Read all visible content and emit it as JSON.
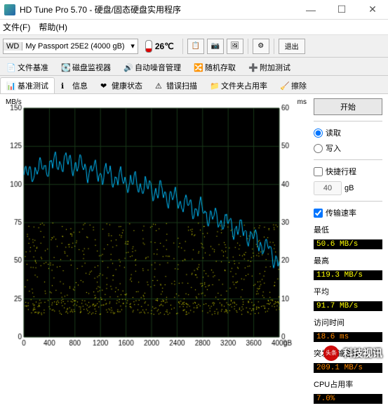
{
  "window": {
    "title": "HD Tune Pro 5.70 - 硬盘/固态硬盘实用程序",
    "min": "—",
    "max": "☐",
    "close": "✕"
  },
  "menu": {
    "file": "文件(F)",
    "help": "帮助(H)"
  },
  "drive": {
    "vendor": "WD",
    "model": "My Passport 25E2 (4000 gB)",
    "dd": "▾"
  },
  "temp": "26℃",
  "toolbar": {
    "copy": "📋",
    "shot": "📷",
    "cap": "🖼",
    "opt": "⚙",
    "exit": "退出"
  },
  "tabs_row1": [
    {
      "icon": "📄",
      "label": "文件基准"
    },
    {
      "icon": "💽",
      "label": "磁盘监视器"
    },
    {
      "icon": "🔊",
      "label": "自动噪音管理"
    },
    {
      "icon": "🔀",
      "label": "随机存取"
    },
    {
      "icon": "➕",
      "label": "附加测试"
    }
  ],
  "tabs_row2": [
    {
      "icon": "📊",
      "label": "基准测试",
      "active": true
    },
    {
      "icon": "ℹ",
      "label": "信息"
    },
    {
      "icon": "❤",
      "label": "健康状态"
    },
    {
      "icon": "⚠",
      "label": "错误扫描"
    },
    {
      "icon": "📁",
      "label": "文件夹占用率"
    },
    {
      "icon": "🧹",
      "label": "擦除"
    }
  ],
  "chart": {
    "ylabel_left": "MB/s",
    "ylabel_right": "ms",
    "xlabel": "gB"
  },
  "side": {
    "start": "开始",
    "read": "读取",
    "write": "写入",
    "short": "快捷行程",
    "short_val": "40",
    "short_unit": "gB",
    "transfer": "传输速率",
    "min_l": "最低",
    "min_v": "50.6 MB/s",
    "max_l": "最高",
    "max_v": "119.3 MB/s",
    "avg_l": "平均",
    "avg_v": "91.7 MB/s",
    "acc_l": "访问时间",
    "acc_v": "18.6 ms",
    "burst_l": "突发传输速率",
    "burst_v": "209.1 MB/s",
    "cpu_l": "CPU占用率",
    "cpu_v": "7.0%"
  },
  "watermark": {
    "logo": "头条",
    "name": "科技视讯"
  },
  "chart_data": {
    "type": "line+scatter",
    "xlim": [
      0,
      4000
    ],
    "x_ticks": [
      0,
      400,
      800,
      1200,
      1600,
      2000,
      2400,
      2800,
      3200,
      3600,
      4000
    ],
    "left_axis": {
      "label": "MB/s",
      "lim": [
        0,
        150
      ],
      "ticks": [
        0,
        25,
        50,
        75,
        100,
        125,
        150
      ]
    },
    "right_axis": {
      "label": "ms",
      "lim": [
        0,
        60
      ],
      "ticks": [
        0,
        10,
        20,
        30,
        40,
        50,
        60
      ]
    },
    "series": [
      {
        "name": "transfer_rate_MBps",
        "axis": "left",
        "style": "line",
        "color": "#00bfff",
        "x": [
          0,
          200,
          400,
          600,
          800,
          1000,
          1200,
          1400,
          1600,
          1800,
          2000,
          2200,
          2400,
          2600,
          2800,
          3000,
          3200,
          3400,
          3600,
          3800,
          4000
        ],
        "y": [
          105,
          110,
          112,
          115,
          113,
          110,
          108,
          105,
          102,
          100,
          97,
          94,
          90,
          86,
          82,
          78,
          74,
          70,
          65,
          58,
          50
        ]
      },
      {
        "name": "access_time_ms",
        "axis": "right",
        "style": "scatter",
        "color": "#ffff00",
        "note": "dense scatter ~6–30ms across full range, band centered ~15–22ms with lower ridge ~6–8ms",
        "x_sample": [
          50,
          300,
          600,
          900,
          1200,
          1500,
          1800,
          2100,
          2400,
          2700,
          3000,
          3300,
          3600,
          3900
        ],
        "y_sample": [
          7,
          12,
          15,
          18,
          17,
          20,
          22,
          21,
          23,
          24,
          22,
          23,
          24,
          25
        ]
      }
    ]
  }
}
